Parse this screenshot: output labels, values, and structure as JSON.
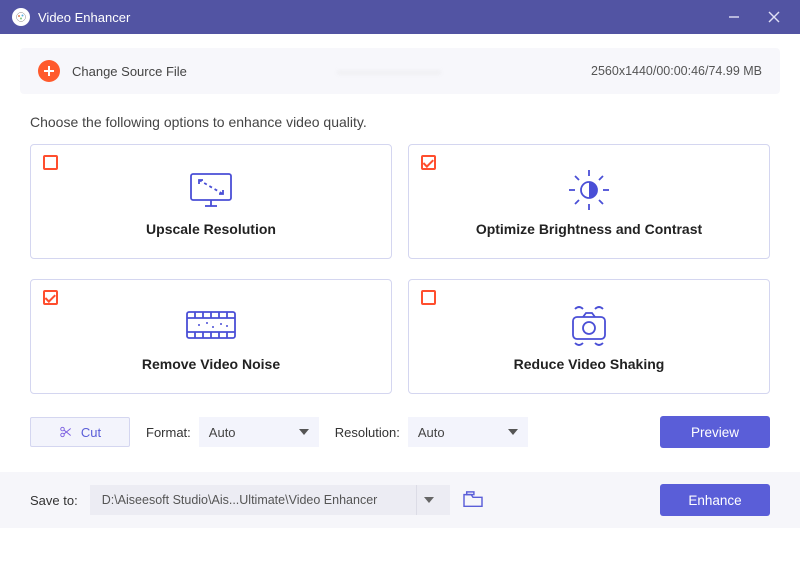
{
  "titlebar": {
    "title": "Video Enhancer"
  },
  "source": {
    "change_label": "Change Source File",
    "filename_blurred": "————————",
    "meta": "2560x1440/00:00:46/74.99 MB"
  },
  "instruction": "Choose the following options to enhance video quality.",
  "options": {
    "upscale": {
      "label": "Upscale Resolution",
      "checked": false
    },
    "brightness": {
      "label": "Optimize Brightness and Contrast",
      "checked": true
    },
    "noise": {
      "label": "Remove Video Noise",
      "checked": true
    },
    "shaking": {
      "label": "Reduce Video Shaking",
      "checked": false
    }
  },
  "controls": {
    "cut_label": "Cut",
    "format_label": "Format:",
    "format_value": "Auto",
    "resolution_label": "Resolution:",
    "resolution_value": "Auto",
    "preview_label": "Preview"
  },
  "footer": {
    "save_to_label": "Save to:",
    "path": "D:\\Aiseesoft Studio\\Ais...Ultimate\\Video Enhancer",
    "enhance_label": "Enhance"
  }
}
